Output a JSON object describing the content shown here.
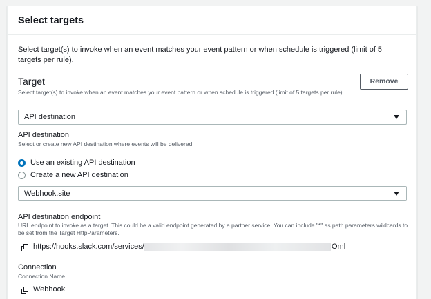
{
  "panel": {
    "title": "Select targets",
    "description": "Select target(s) to invoke when an event matches your event pattern or when schedule is triggered (limit of 5 targets per rule)."
  },
  "target": {
    "label": "Target",
    "description": "Select target(s) to invoke when an event matches your event pattern or when schedule is triggered (limit of 5 targets per rule).",
    "remove_label": "Remove",
    "type_selected": "API destination"
  },
  "api_destination": {
    "label": "API destination",
    "description": "Select or create new API destination where events will be delivered.",
    "options": [
      {
        "label": "Use an existing API destination",
        "checked": true
      },
      {
        "label": "Create a new API destination",
        "checked": false
      }
    ],
    "selected": "Webhook.site"
  },
  "endpoint": {
    "label": "API destination endpoint",
    "description": "URL endpoint to invoke as a target. This could be a valid endpoint generated by a partner service. You can include \"*\" as path parameters wildcards to be set from the Target HttpParameters.",
    "url_prefix": "https://hooks.slack.com/services/",
    "url_suffix": "Oml"
  },
  "connection": {
    "label": "Connection",
    "sublabel": "Connection Name",
    "name": "Webhook"
  },
  "colors": {
    "accent": "#0073bb",
    "text": "#16191f",
    "secondary_text": "#545b64",
    "border": "#aab7b8"
  },
  "icons": {
    "select_caret": "caret-down-icon",
    "copy": "copy-icon"
  }
}
